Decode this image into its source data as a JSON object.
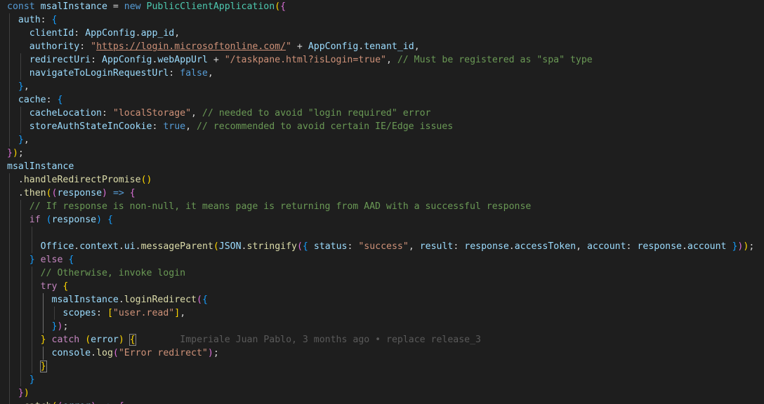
{
  "editor": {
    "blame_annotation": "Imperiale Juan Pablo, 3 months ago • replace release_3",
    "lines": [
      [
        [
          "k",
          "const"
        ],
        [
          "o",
          " "
        ],
        [
          "v",
          "msalInstance"
        ],
        [
          "o",
          " = "
        ],
        [
          "k",
          "new"
        ],
        [
          "o",
          " "
        ],
        [
          "cls",
          "PublicClientApplication"
        ],
        [
          "b1",
          "("
        ],
        [
          "b2",
          "{"
        ]
      ],
      [
        [
          "o",
          "  "
        ],
        [
          "p",
          "auth"
        ],
        [
          "o",
          ": "
        ],
        [
          "b3",
          "{"
        ]
      ],
      [
        [
          "o",
          "    "
        ],
        [
          "p",
          "clientId"
        ],
        [
          "o",
          ": "
        ],
        [
          "v",
          "AppConfig"
        ],
        [
          "o",
          "."
        ],
        [
          "p",
          "app_id"
        ],
        [
          "o",
          ","
        ]
      ],
      [
        [
          "o",
          "    "
        ],
        [
          "p",
          "authority"
        ],
        [
          "o",
          ": "
        ],
        [
          "s",
          "\""
        ],
        [
          "u",
          "https://login.microsoftonline.com/"
        ],
        [
          "s",
          "\""
        ],
        [
          "o",
          " + "
        ],
        [
          "v",
          "AppConfig"
        ],
        [
          "o",
          "."
        ],
        [
          "p",
          "tenant_id"
        ],
        [
          "o",
          ","
        ]
      ],
      [
        [
          "o",
          "    "
        ],
        [
          "p",
          "redirectUri"
        ],
        [
          "o",
          ": "
        ],
        [
          "v",
          "AppConfig"
        ],
        [
          "o",
          "."
        ],
        [
          "p",
          "webAppUrl"
        ],
        [
          "o",
          " + "
        ],
        [
          "s",
          "\"/taskpane.html?isLogin=true\""
        ],
        [
          "o",
          ", "
        ],
        [
          "cm",
          "// Must be registered as \"spa\" type"
        ]
      ],
      [
        [
          "o",
          "    "
        ],
        [
          "p",
          "navigateToLoginRequestUrl"
        ],
        [
          "o",
          ": "
        ],
        [
          "k",
          "false"
        ],
        [
          "o",
          ","
        ]
      ],
      [
        [
          "o",
          "  "
        ],
        [
          "b3",
          "}"
        ],
        [
          "o",
          ","
        ]
      ],
      [
        [
          "o",
          "  "
        ],
        [
          "p",
          "cache"
        ],
        [
          "o",
          ": "
        ],
        [
          "b3",
          "{"
        ]
      ],
      [
        [
          "o",
          "    "
        ],
        [
          "p",
          "cacheLocation"
        ],
        [
          "o",
          ": "
        ],
        [
          "s",
          "\"localStorage\""
        ],
        [
          "o",
          ", "
        ],
        [
          "cm",
          "// needed to avoid \"login required\" error"
        ]
      ],
      [
        [
          "o",
          "    "
        ],
        [
          "p",
          "storeAuthStateInCookie"
        ],
        [
          "o",
          ": "
        ],
        [
          "k",
          "true"
        ],
        [
          "o",
          ", "
        ],
        [
          "cm",
          "// recommended to avoid certain IE/Edge issues"
        ]
      ],
      [
        [
          "o",
          "  "
        ],
        [
          "b3",
          "}"
        ],
        [
          "o",
          ","
        ]
      ],
      [
        [
          "b2",
          "}"
        ],
        [
          "b1",
          ")"
        ],
        [
          "o",
          ";"
        ]
      ],
      [
        [
          "v",
          "msalInstance"
        ]
      ],
      [
        [
          "o",
          "  ."
        ],
        [
          "f",
          "handleRedirectPromise"
        ],
        [
          "b1",
          "()"
        ]
      ],
      [
        [
          "o",
          "  ."
        ],
        [
          "f",
          "then"
        ],
        [
          "b1",
          "("
        ],
        [
          "b2",
          "("
        ],
        [
          "v",
          "response"
        ],
        [
          "b2",
          ")"
        ],
        [
          "o",
          " "
        ],
        [
          "k",
          "=>"
        ],
        [
          "o",
          " "
        ],
        [
          "b2",
          "{"
        ]
      ],
      [
        [
          "o",
          "    "
        ],
        [
          "cm",
          "// If response is non-null, it means page is returning from AAD with a successful response"
        ]
      ],
      [
        [
          "o",
          "    "
        ],
        [
          "c",
          "if"
        ],
        [
          "o",
          " "
        ],
        [
          "b3",
          "("
        ],
        [
          "v",
          "response"
        ],
        [
          "b3",
          ")"
        ],
        [
          "o",
          " "
        ],
        [
          "b3",
          "{"
        ]
      ],
      [
        [
          "o",
          ""
        ]
      ],
      [
        [
          "o",
          "      "
        ],
        [
          "v",
          "Office"
        ],
        [
          "o",
          "."
        ],
        [
          "v",
          "context"
        ],
        [
          "o",
          "."
        ],
        [
          "v",
          "ui"
        ],
        [
          "o",
          "."
        ],
        [
          "f",
          "messageParent"
        ],
        [
          "b1",
          "("
        ],
        [
          "v",
          "JSON"
        ],
        [
          "o",
          "."
        ],
        [
          "f",
          "stringify"
        ],
        [
          "b2",
          "("
        ],
        [
          "b3",
          "{"
        ],
        [
          "o",
          " "
        ],
        [
          "p",
          "status"
        ],
        [
          "o",
          ": "
        ],
        [
          "s",
          "\"success\""
        ],
        [
          "o",
          ", "
        ],
        [
          "p",
          "result"
        ],
        [
          "o",
          ": "
        ],
        [
          "v",
          "response"
        ],
        [
          "o",
          "."
        ],
        [
          "p",
          "accessToken"
        ],
        [
          "o",
          ", "
        ],
        [
          "p",
          "account"
        ],
        [
          "o",
          ": "
        ],
        [
          "v",
          "response"
        ],
        [
          "o",
          "."
        ],
        [
          "p",
          "account"
        ],
        [
          "o",
          " "
        ],
        [
          "b3",
          "}"
        ],
        [
          "b2",
          ")"
        ],
        [
          "b1",
          ")"
        ],
        [
          "o",
          ";"
        ]
      ],
      [
        [
          "o",
          "    "
        ],
        [
          "b3",
          "}"
        ],
        [
          "o",
          " "
        ],
        [
          "c",
          "else"
        ],
        [
          "o",
          " "
        ],
        [
          "b3",
          "{"
        ]
      ],
      [
        [
          "o",
          "      "
        ],
        [
          "cm",
          "// Otherwise, invoke login"
        ]
      ],
      [
        [
          "o",
          "      "
        ],
        [
          "c",
          "try"
        ],
        [
          "o",
          " "
        ],
        [
          "b1",
          "{"
        ]
      ],
      [
        [
          "o",
          "        "
        ],
        [
          "v",
          "msalInstance"
        ],
        [
          "o",
          "."
        ],
        [
          "f",
          "loginRedirect"
        ],
        [
          "b2",
          "("
        ],
        [
          "b3",
          "{"
        ]
      ],
      [
        [
          "o",
          "          "
        ],
        [
          "p",
          "scopes"
        ],
        [
          "o",
          ": "
        ],
        [
          "b1",
          "["
        ],
        [
          "s",
          "\"user.read\""
        ],
        [
          "b1",
          "]"
        ],
        [
          "o",
          ","
        ]
      ],
      [
        [
          "o",
          "        "
        ],
        [
          "b3",
          "}"
        ],
        [
          "b2",
          ")"
        ],
        [
          "o",
          ";"
        ]
      ],
      [
        [
          "o",
          "      "
        ],
        [
          "b1",
          "}"
        ],
        [
          "o",
          " "
        ],
        [
          "c",
          "catch"
        ],
        [
          "o",
          " "
        ],
        [
          "b1",
          "("
        ],
        [
          "v",
          "error"
        ],
        [
          "b1",
          ")"
        ],
        [
          "o",
          " "
        ],
        [
          "bm",
          "{"
        ],
        [
          "o",
          "        "
        ],
        [
          "blame",
          "Imperiale Juan Pablo, 3 months ago • replace release_3"
        ]
      ],
      [
        [
          "o",
          "        "
        ],
        [
          "v",
          "console"
        ],
        [
          "o",
          "."
        ],
        [
          "f",
          "log"
        ],
        [
          "b2",
          "("
        ],
        [
          "s",
          "\"Error redirect\""
        ],
        [
          "b2",
          ")"
        ],
        [
          "o",
          ";"
        ]
      ],
      [
        [
          "o",
          "      "
        ],
        [
          "bm",
          "}"
        ]
      ],
      [
        [
          "o",
          "    "
        ],
        [
          "b3",
          "}"
        ]
      ],
      [
        [
          "o",
          "  "
        ],
        [
          "b2",
          "}"
        ],
        [
          "b1",
          ")"
        ]
      ],
      [
        [
          "o",
          "  ."
        ],
        [
          "f",
          "catch"
        ],
        [
          "b1",
          "("
        ],
        [
          "b2",
          "("
        ],
        [
          "v",
          "error"
        ],
        [
          "b2",
          ")"
        ],
        [
          "o",
          " "
        ],
        [
          "k",
          "=>"
        ],
        [
          "o",
          " "
        ],
        [
          "b2",
          "{"
        ]
      ]
    ]
  }
}
